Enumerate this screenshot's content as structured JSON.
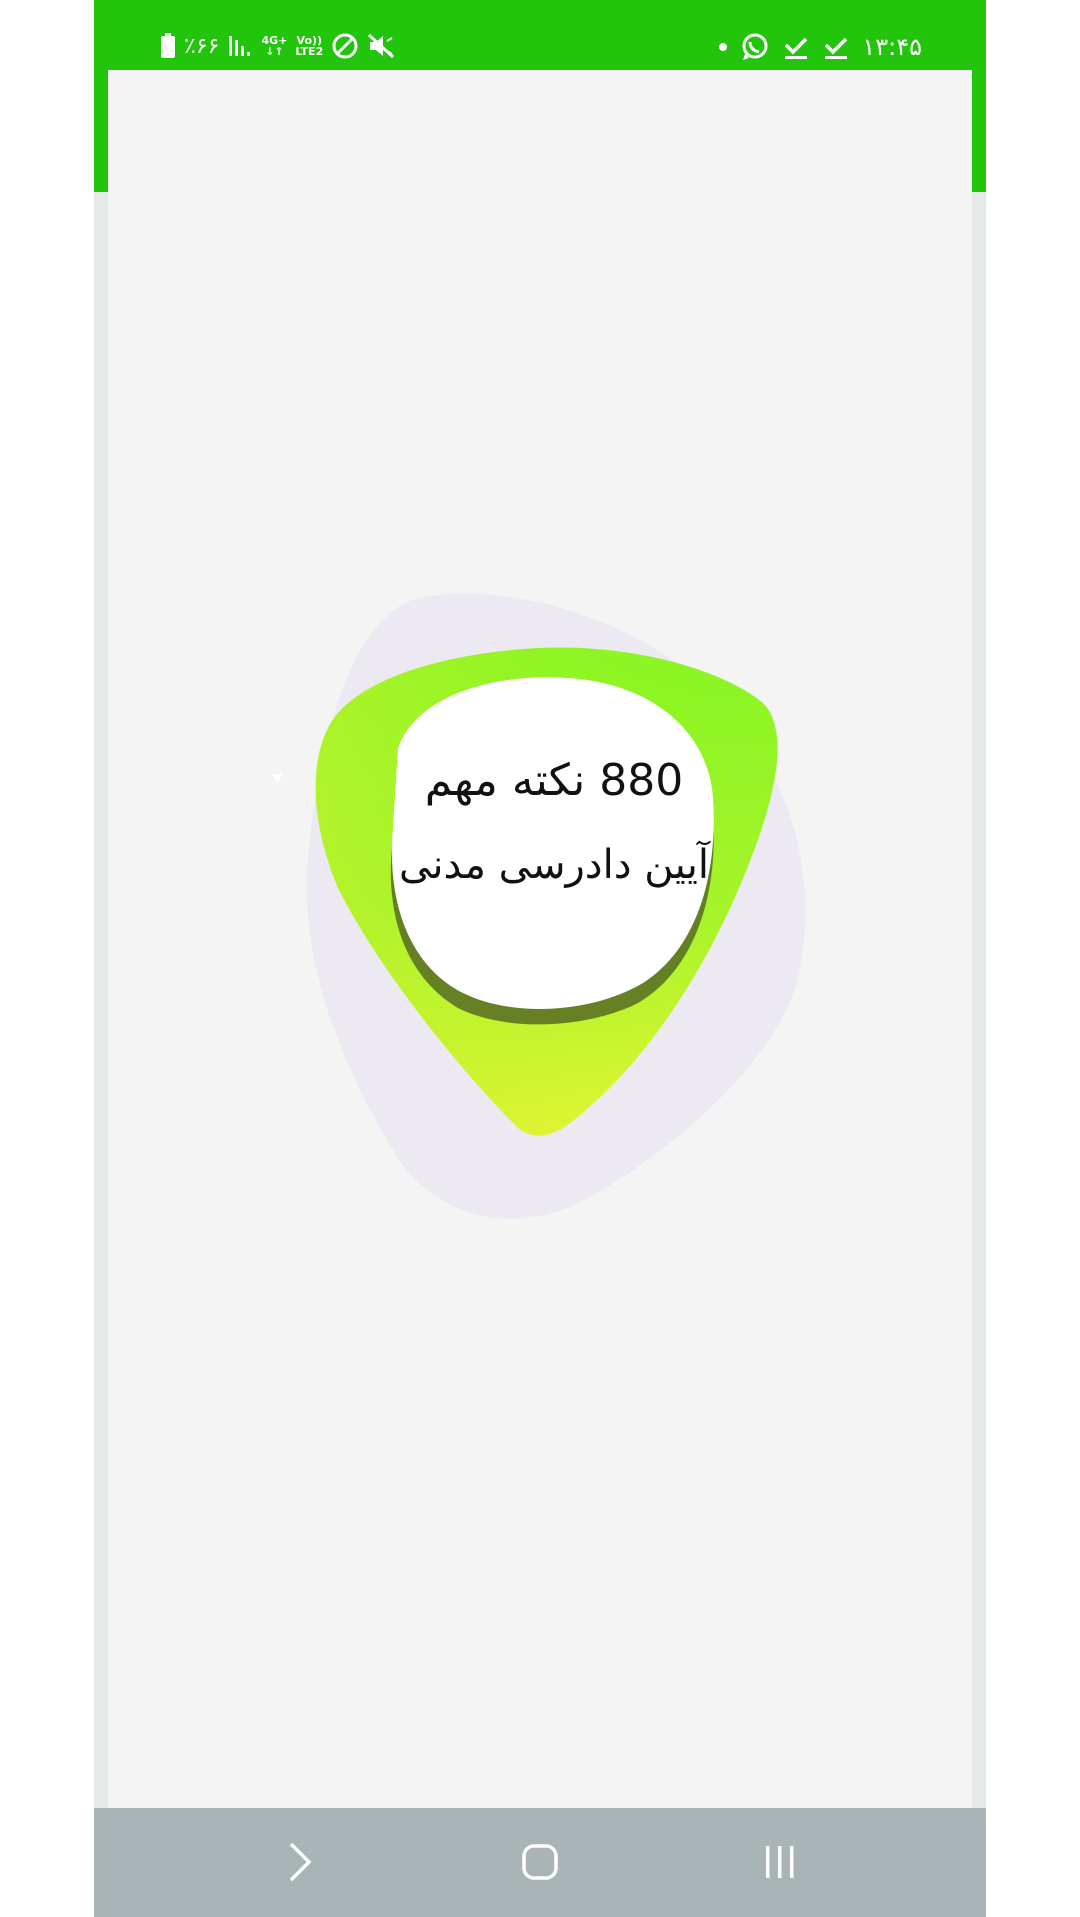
{
  "status_bar": {
    "time": "۱۳:۴۵",
    "battery_percent": "٪۶۶",
    "network_top": "4G+",
    "network_bottom": "LTE2",
    "volte": "Vo))",
    "icons_right": [
      "dot-icon",
      "whatsapp-icon",
      "check-download-icon",
      "check-download-icon"
    ],
    "icons_left": [
      "battery-icon",
      "signal-icon",
      "network-type-icon",
      "do-not-disturb-icon",
      "mute-icon"
    ]
  },
  "splash": {
    "title_line1": "880  نکته مهم",
    "title_line2": "آیین دادرسی مدنی"
  },
  "nav_bar": {
    "buttons": [
      "back-icon",
      "home-icon",
      "recents-icon"
    ]
  },
  "colors": {
    "status_bar": "#22c40c",
    "nav_bar": "#a9b4b6",
    "background": "#f4f4f5",
    "blob_green": "#88f522",
    "blob_yellow": "#f2f535",
    "text": "#111111"
  }
}
